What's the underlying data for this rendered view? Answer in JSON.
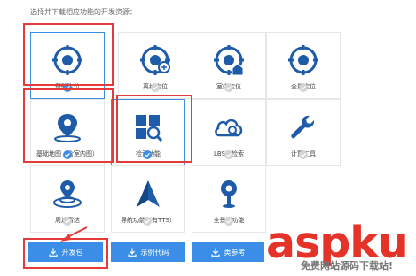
{
  "header": {
    "text": "选择并下载相应功能的开发资源："
  },
  "tiles": [
    {
      "label": "基础定位",
      "icon": "location-target-icon",
      "checked": true
    },
    {
      "label": "离线定位",
      "icon": "offline-location-icon",
      "checked": false
    },
    {
      "label": "室内定位",
      "icon": "indoor-location-icon",
      "checked": false
    },
    {
      "label": "全量定位",
      "icon": "full-location-icon",
      "checked": false
    },
    {
      "label": "基础地图（含室内图）",
      "icon": "map-pin-icon",
      "checked": true
    },
    {
      "label": "检索功能",
      "icon": "search-icon",
      "checked": true
    },
    {
      "label": "LBS云检索",
      "icon": "cloud-search-icon",
      "checked": false
    },
    {
      "label": "计算工具",
      "icon": "wrench-icon",
      "checked": false
    },
    {
      "label": "周边雷达",
      "icon": "radar-pin-icon",
      "checked": false
    },
    {
      "label": "导航功能（有TTS）",
      "icon": "navigation-icon",
      "checked": false
    },
    {
      "label": "全景图功能",
      "icon": "panorama-icon",
      "checked": false
    }
  ],
  "buttons": {
    "download": "开发包",
    "sample": "示例代码",
    "reference": "类参考"
  },
  "watermark": {
    "main": "aspku",
    "sub": "免费网站源码下载站!"
  },
  "colors": {
    "primary": "#3b8ee8",
    "highlight": "#e43a3a",
    "check_off": "#d4d4d4",
    "watermark": "#e5332a"
  }
}
